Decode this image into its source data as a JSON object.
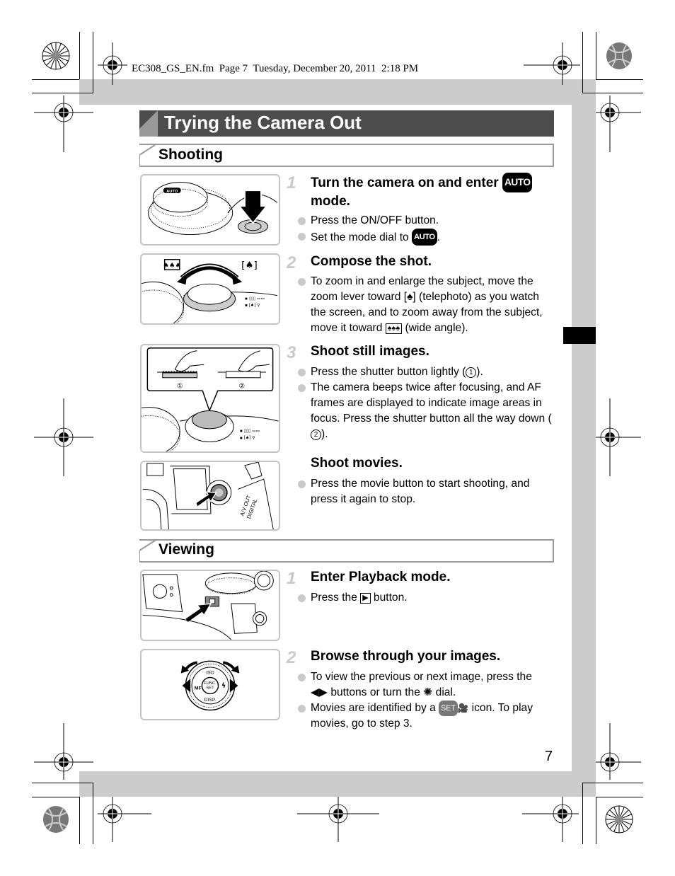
{
  "print_slug": "EC308_GS_EN.fm  Page 7  Tuesday, December 20, 2011  2:18 PM",
  "page_title": "Trying the Camera Out",
  "page_number": "7",
  "sections": {
    "shooting": {
      "heading": "Shooting",
      "steps": [
        {
          "number": "1",
          "title_pre": "Turn the camera on and enter ",
          "title_icon": "AUTO",
          "title_post": "mode.",
          "bullets": [
            {
              "text": "Press the ON/OFF button."
            },
            {
              "pre": "Set the mode dial to ",
              "icon": "AUTO",
              "post": "."
            }
          ]
        },
        {
          "number": "2",
          "title": "Compose the shot.",
          "bullets": [
            {
              "pre": "To zoom in and enlarge the subject, move the zoom lever toward ",
              "icon1": "[♠]",
              "mid": " (telephoto) as you watch the screen, and to zoom away from the subject, move it toward ",
              "icon2": "♠♠♠",
              "post": " (wide angle)."
            }
          ]
        },
        {
          "number": "3",
          "title": "Shoot still images.",
          "bullets": [
            {
              "pre": "Press the shutter button lightly (",
              "icon": "1",
              "post": ")."
            },
            {
              "pre": "The camera beeps twice after focusing, and AF frames are displayed to indicate image areas in focus. Press the shutter button all the way down (",
              "icon": "2",
              "post": ")."
            }
          ]
        },
        {
          "number": "",
          "title": "Shoot movies.",
          "bullets": [
            {
              "text": "Press the movie button to start shooting, and press it again to stop."
            }
          ]
        }
      ]
    },
    "viewing": {
      "heading": "Viewing",
      "steps": [
        {
          "number": "1",
          "title": "Enter Playback mode.",
          "bullets": [
            {
              "pre": "Press the ",
              "icon": "▶",
              "post": " button."
            }
          ]
        },
        {
          "number": "2",
          "title": "Browse through your images.",
          "bullets": [
            {
              "pre": "To view the previous or next image, press the ",
              "icon1": "◀▶",
              "mid": " buttons or turn the ",
              "icon2": "✺",
              "post": " dial."
            },
            {
              "pre": "Movies are identified by a ",
              "icon1": "SET",
              "icon2": "🎥",
              "post": " icon. To play movies, go to step 3."
            }
          ]
        }
      ]
    }
  },
  "illustrations": {
    "mode_dial_label": "AUTO",
    "shutter_labels": [
      "1",
      "2"
    ],
    "port_label_1": "A/V OUT",
    "port_label_2": "DIGITAL",
    "dial_labels": {
      "top": "ISO",
      "bottom": "DISP.",
      "center_1": "FUNC.",
      "center_2": "SET",
      "left": "MF",
      "right": "ϟ"
    }
  },
  "colors": {
    "title_bar": "#4d4d4d",
    "frame_gray": "#cccccc",
    "step_number": "#c9c9c9",
    "bullet": "#c9c9c9",
    "section_border": "#999999"
  }
}
